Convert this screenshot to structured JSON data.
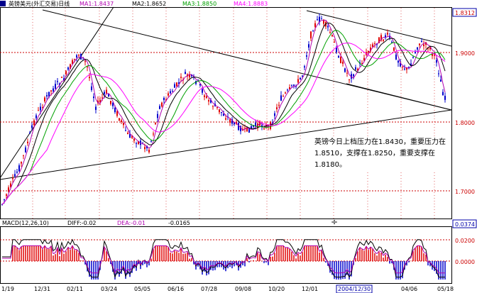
{
  "header": {
    "symbol_label": "英镑美元(外汇交易)日线",
    "ma1": "MA1:1.8437",
    "ma2": "MA2:1.8652",
    "ma3": "MA3:1.8850",
    "ma4": "MA4:1.8883"
  },
  "macd_header": {
    "name": "MACD(12,26,10)",
    "diff": "DIFF:-0.02",
    "dea": "DEA:-0.01",
    "macd_value": "-0.0165"
  },
  "price_axis": {
    "top_value": "1.8312",
    "macd_top_value": "0.0374",
    "ticks": [
      "1.9000",
      "1.8000",
      "1.7000"
    ],
    "macd_ticks": [
      "0.0200",
      "0.0000"
    ]
  },
  "x_axis": {
    "dates": [
      "1/19",
      "12/31",
      "02/11",
      "03/24",
      "05/05",
      "06/16",
      "07/28",
      "09/08",
      "10/20",
      "12/01",
      "2004/12/30",
      "04/06",
      "05/18"
    ]
  },
  "annotation": {
    "text": "英镑今日上档压力在1.8430，重要压力在1.8510，支撑在1.8250，重要支撑在1.8180。"
  },
  "colors": {
    "up_candle": "#e00000",
    "down_candle": "#0000cc",
    "ma1": "#b000b0",
    "ma2": "#000000",
    "ma3": "#00a000",
    "ma4": "#ff00ff",
    "grid_red": "#cc0000",
    "highlight_box": "#0000aa"
  }
}
